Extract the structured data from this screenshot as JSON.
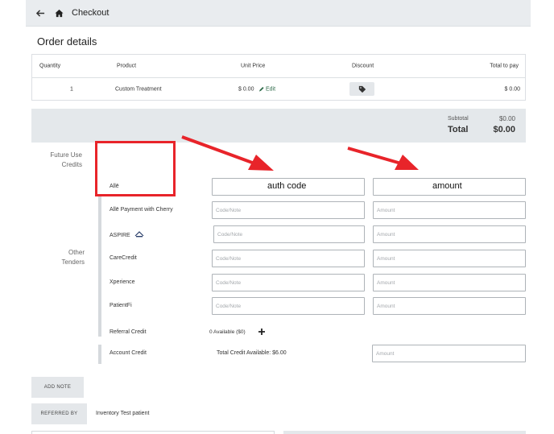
{
  "header": {
    "title": "Checkout",
    "back_icon": "back-arrow-icon",
    "home_icon": "home-icon"
  },
  "order": {
    "section_title": "Order details",
    "columns": [
      "Quantity",
      "Product",
      "Unit Price",
      "Discount",
      "Total to pay"
    ],
    "rows": [
      {
        "quantity": "1",
        "product": "Custom Treatment",
        "unit_price": "$ 0.00",
        "edit_label": "Edit",
        "total": "$ 0.00"
      }
    ]
  },
  "totals": {
    "subtotal_label": "Subtotal",
    "subtotal_value": "$0.00",
    "total_label": "Total",
    "total_value": "$0.00"
  },
  "future_use": {
    "label_line1": "Future Use",
    "label_line2": "Credits"
  },
  "other_tenders": {
    "label_line1": "Other",
    "label_line2": "Tenders",
    "items": [
      {
        "name": "Allē",
        "code_placeholder": "",
        "amount_placeholder": ""
      },
      {
        "name": "Allē Payment with Cherry",
        "code_placeholder": "Code/Note",
        "amount_placeholder": "Amount"
      },
      {
        "name": "ASPIRE",
        "code_placeholder": "Code/Note",
        "amount_placeholder": "Amount"
      },
      {
        "name": "CareCredit",
        "code_placeholder": "Code/Note",
        "amount_placeholder": "Amount"
      },
      {
        "name": "Xperience",
        "code_placeholder": "Code/Note",
        "amount_placeholder": "Amount"
      },
      {
        "name": "PatientFi",
        "code_placeholder": "Code/Note",
        "amount_placeholder": "Amount"
      }
    ],
    "referral": {
      "name": "Referral Credit",
      "available": "0 Available ($0)"
    },
    "account": {
      "name": "Account Credit",
      "available": "Total Credit Available: $6.00",
      "amount_placeholder": "Amount"
    }
  },
  "actions": {
    "add_note": "ADD NOTE",
    "referred_by": "REFERRED BY",
    "referred_value": "Inventory Test patient"
  },
  "annotations": {
    "auth_code": "auth code",
    "amount": "amount",
    "color": "#e8242a"
  }
}
